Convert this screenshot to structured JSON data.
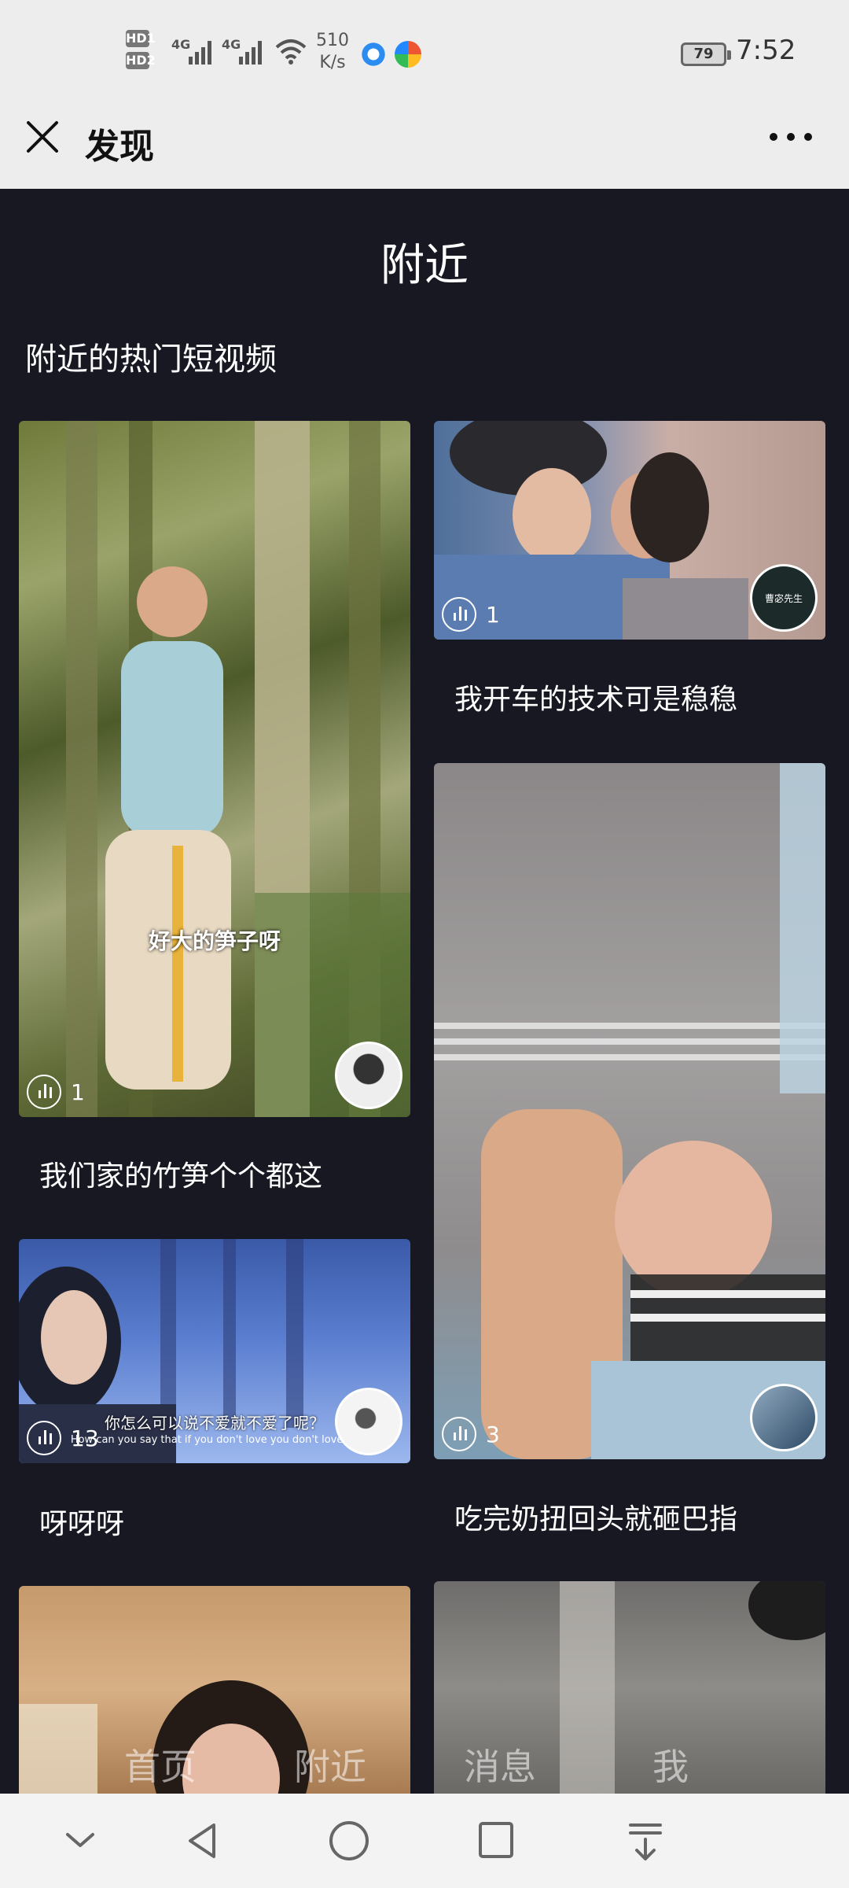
{
  "status_bar": {
    "hd1": "HD1",
    "hd2": "HD2",
    "net1": "4G",
    "net2": "4G",
    "speed_value": "510",
    "speed_unit": "K/s",
    "battery": "79",
    "time": "7:52"
  },
  "header": {
    "title": "发现",
    "close_icon": "close-icon",
    "more_icon": "more-icon"
  },
  "section": {
    "title": "附近",
    "subtitle": "附近的热门短视频"
  },
  "videos": [
    {
      "title": "我们家的竹笋个个都这",
      "plays": "1",
      "overlay_caption": "好大的笋子呀"
    },
    {
      "title": "我开车的技术可是稳稳",
      "plays": "1",
      "avatar_text": "曹宓先生"
    },
    {
      "title": "呀呀呀",
      "plays": "13",
      "overlay_caption": "你怎么可以说不爱就不爱了呢？",
      "overlay_caption_en": "How can you say that if you don't love you don't love it?"
    },
    {
      "title": "吃完奶扭回头就砸巴指",
      "plays": "3"
    }
  ],
  "bottom_tabs": [
    "首页",
    "附近",
    "消息",
    "我"
  ],
  "colors": {
    "background": "#171822",
    "bar": "#ededed"
  }
}
